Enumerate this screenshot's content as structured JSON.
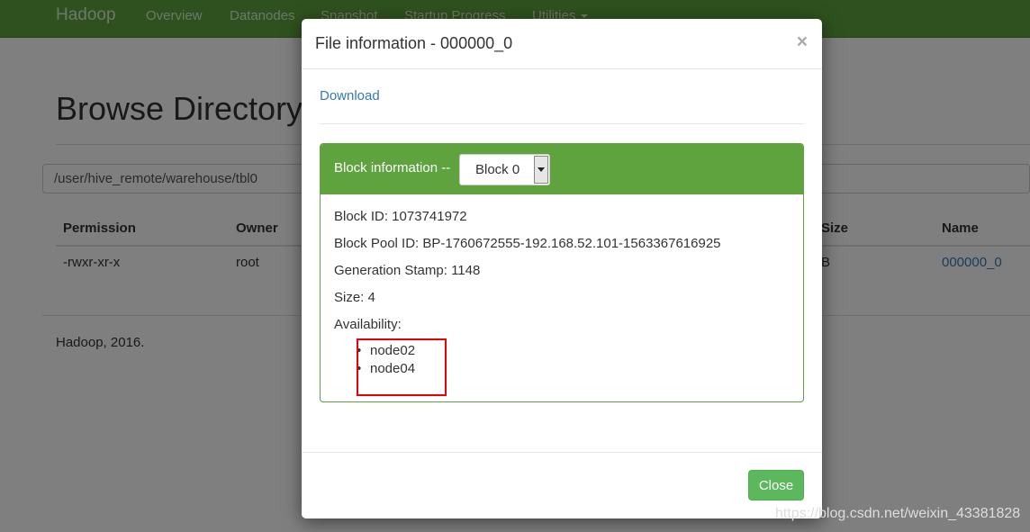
{
  "navbar": {
    "brand": "Hadoop",
    "items": [
      "Overview",
      "Datanodes",
      "Snapshot",
      "Startup Progress",
      "Utilities"
    ]
  },
  "page": {
    "title": "Browse Directory",
    "path": "/user/hive_remote/warehouse/tbl0",
    "columns": [
      "Permission",
      "Owner",
      "Size",
      "Name"
    ],
    "row": {
      "permission": "-rwxr-xr-x",
      "owner": "root",
      "size": "B",
      "name": "000000_0"
    },
    "footer": "Hadoop, 2016."
  },
  "modal": {
    "title": "File information - 000000_0",
    "close_symbol": "×",
    "download_label": "Download",
    "panel_heading": "Block information --",
    "block_selected": "Block 0",
    "block_id": "Block ID: 1073741972",
    "block_pool_id": "Block Pool ID: BP-1760672555-192.168.52.101-1563367616925",
    "generation_stamp": "Generation Stamp: 1148",
    "size": "Size: 4",
    "availability_label": "Availability:",
    "nodes": [
      "node02",
      "node04"
    ],
    "close_button": "Close"
  },
  "watermark": "https://blog.csdn.net/weixin_43381828",
  "colors": {
    "navbar_green": "#5fa33e",
    "panel_green": "#5fa33e",
    "close_button_green": "#5cb85c",
    "link_blue": "#337ab7",
    "highlight_red": "#e00000"
  }
}
